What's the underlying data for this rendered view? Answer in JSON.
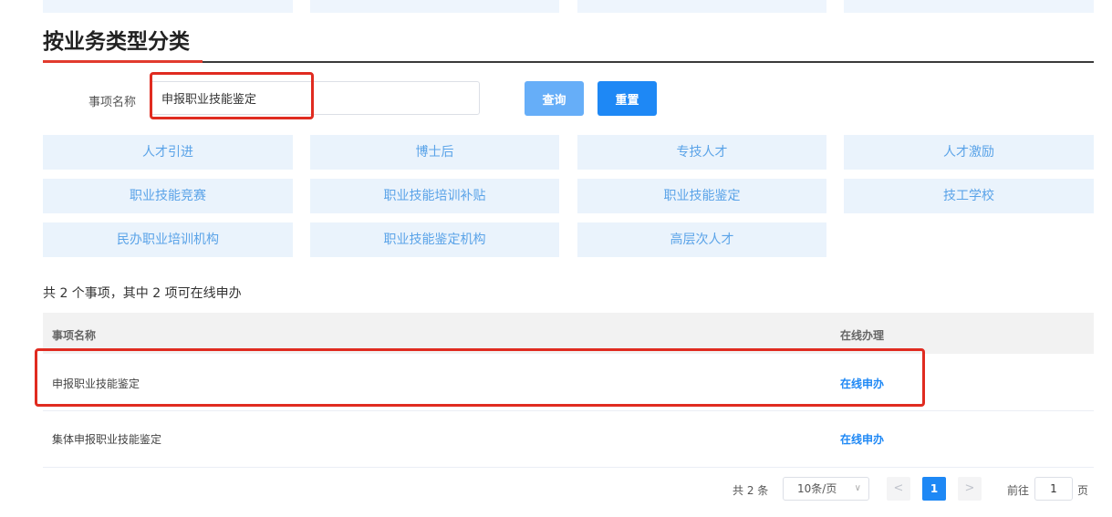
{
  "section": {
    "title": "按业务类型分类"
  },
  "search": {
    "label": "事项名称",
    "value": "申报职业技能鉴定",
    "query_button": "查询",
    "reset_button": "重置"
  },
  "categories": [
    "人才引进",
    "博士后",
    "专技人才",
    "人才激励",
    "职业技能竞赛",
    "职业技能培训补贴",
    "职业技能鉴定",
    "技工学校",
    "民办职业培训机构",
    "职业技能鉴定机构",
    "高层次人才"
  ],
  "summary": "共 2 个事项，其中 2 项可在线申办",
  "table": {
    "headers": {
      "name": "事项名称",
      "online": "在线办理"
    },
    "rows": [
      {
        "name": "申报职业技能鉴定",
        "action": "在线申办"
      },
      {
        "name": "集体申报职业技能鉴定",
        "action": "在线申办"
      }
    ]
  },
  "pagination": {
    "total": "共 2 条",
    "page_size": "10条/页",
    "prev": "<",
    "current": "1",
    "next": ">",
    "goto_label": "前往",
    "goto_value": "1",
    "goto_unit": "页"
  },
  "colors": {
    "accent": "#1e88f5",
    "highlight": "#e02b20",
    "category_bg": "#eaf3fc",
    "category_text": "#5aa3e8"
  },
  "icons": {
    "caret": "chevron-down-icon"
  }
}
